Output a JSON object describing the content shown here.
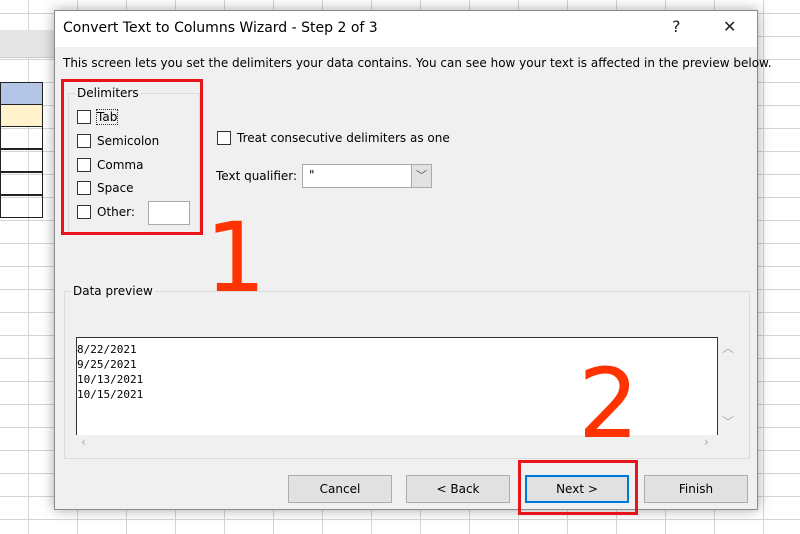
{
  "dialog": {
    "title": "Convert Text to Columns Wizard - Step 2 of 3",
    "help": "?",
    "close": "✕",
    "description": "This screen lets you set the delimiters your data contains.  You can see how your text is affected in the preview below."
  },
  "delimiters": {
    "label": "Delimiters",
    "items": [
      {
        "label": "Tab",
        "checked": false
      },
      {
        "label": "Semicolon",
        "checked": false
      },
      {
        "label": "Comma",
        "checked": false
      },
      {
        "label": "Space",
        "checked": false
      },
      {
        "label": "Other:",
        "checked": false
      }
    ],
    "other_value": ""
  },
  "options": {
    "consecutive_label": "Treat consecutive delimiters as one",
    "consecutive_checked": false,
    "qualifier_label": "Text qualifier:",
    "qualifier_value": "\""
  },
  "preview": {
    "label": "Data preview",
    "rows": [
      "8/22/2021",
      "9/25/2021",
      "10/13/2021",
      "10/15/2021"
    ]
  },
  "buttons": {
    "cancel": "Cancel",
    "back": "< Back",
    "next": "Next >",
    "finish": "Finish"
  },
  "annotations": {
    "step1": "1",
    "step2": "2",
    "color": "#ff3300"
  }
}
